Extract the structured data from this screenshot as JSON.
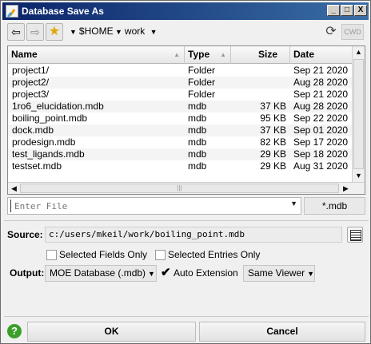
{
  "window": {
    "title": "Database Save As",
    "controls": {
      "minimize": "_",
      "maximize": "□",
      "close": "X"
    }
  },
  "toolbar": {
    "back_icon": "arrow-left-icon",
    "forward_icon": "arrow-right-icon",
    "favorite_icon": "star-icon",
    "breadcrumbs": [
      "$HOME",
      "work"
    ],
    "refresh_icon": "refresh-icon",
    "cwd_label": "CWD"
  },
  "filelist": {
    "columns": [
      "Name",
      "Type",
      "Size",
      "Date"
    ],
    "rows": [
      {
        "name": "project1/",
        "type": "Folder",
        "size": "",
        "date": "Sep 21 2020"
      },
      {
        "name": "project2/",
        "type": "Folder",
        "size": "",
        "date": "Aug 28 2020"
      },
      {
        "name": "project3/",
        "type": "Folder",
        "size": "",
        "date": "Sep 21 2020"
      },
      {
        "name": "1ro6_elucidation.mdb",
        "type": "mdb",
        "size": "37 KB",
        "date": "Aug 28 2020"
      },
      {
        "name": "boiling_point.mdb",
        "type": "mdb",
        "size": "95 KB",
        "date": "Sep 22 2020"
      },
      {
        "name": "dock.mdb",
        "type": "mdb",
        "size": "37 KB",
        "date": "Sep 01 2020"
      },
      {
        "name": "prodesign.mdb",
        "type": "mdb",
        "size": "82 KB",
        "date": "Sep 17 2020"
      },
      {
        "name": "test_ligands.mdb",
        "type": "mdb",
        "size": "29 KB",
        "date": "Sep 18 2020"
      },
      {
        "name": "testset.mdb",
        "type": "mdb",
        "size": "29 KB",
        "date": "Aug 31 2020"
      }
    ]
  },
  "filename": {
    "placeholder": "Enter File",
    "value": "",
    "extension_button": "*.mdb"
  },
  "source": {
    "label": "Source:",
    "path": "c:/users/mkeil/work/boiling_point.mdb"
  },
  "options": {
    "selected_fields_only": {
      "label": "Selected Fields Only",
      "checked": false
    },
    "selected_entries_only": {
      "label": "Selected Entries Only",
      "checked": false
    }
  },
  "output": {
    "label": "Output:",
    "format": "MOE Database (.mdb)",
    "auto_extension": {
      "label": "Auto Extension",
      "checked": true
    },
    "viewer": "Same Viewer"
  },
  "buttons": {
    "help": "?",
    "ok": "OK",
    "cancel": "Cancel"
  }
}
